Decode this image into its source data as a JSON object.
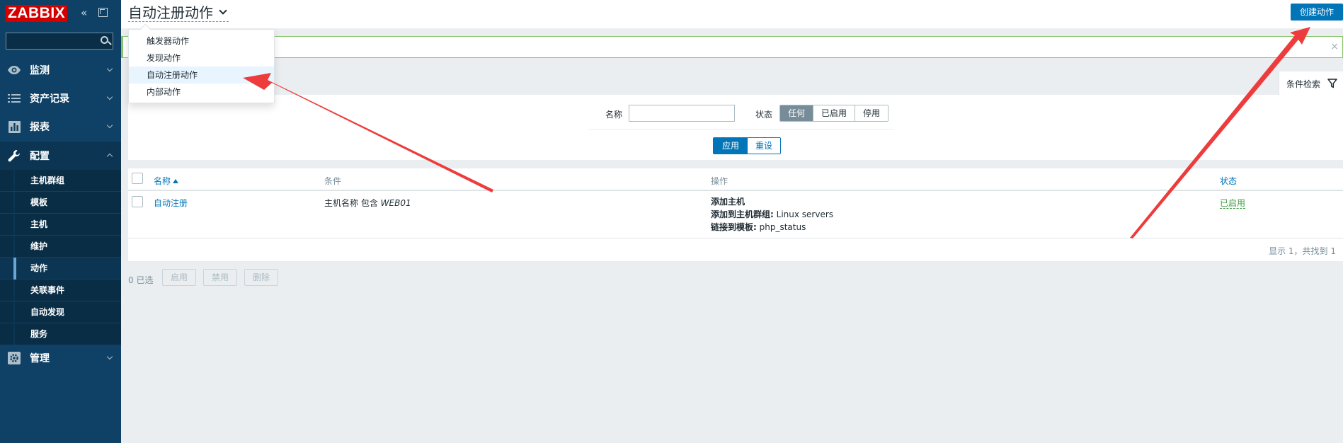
{
  "sidebar": {
    "logo": "ZABBIX",
    "collapse_icon": "collapse-icon",
    "kiosk_icon": "kiosk-mode-icon",
    "search": {
      "placeholder": "",
      "value": ""
    },
    "menu": [
      {
        "label": "监测",
        "icon": "eye-icon"
      },
      {
        "label": "资产记录",
        "icon": "list-icon"
      },
      {
        "label": "报表",
        "icon": "bar-chart-icon"
      },
      {
        "label": "配置",
        "icon": "wrench-icon"
      },
      {
        "label": "管理",
        "icon": "gear-icon"
      }
    ],
    "submenu": [
      {
        "label": "主机群组"
      },
      {
        "label": "模板"
      },
      {
        "label": "主机"
      },
      {
        "label": "维护"
      },
      {
        "label": "动作"
      },
      {
        "label": "关联事件"
      },
      {
        "label": "自动发现"
      },
      {
        "label": "服务"
      }
    ]
  },
  "header": {
    "title": "自动注册动作",
    "create_button": "创建动作"
  },
  "dropdown": {
    "items": [
      {
        "label": "触发器动作"
      },
      {
        "label": "发现动作"
      },
      {
        "label": "自动注册动作"
      },
      {
        "label": "内部动作"
      }
    ]
  },
  "message": {
    "close": "×"
  },
  "filter": {
    "tab_label": "条件检索",
    "name_label": "名称",
    "name_value": "",
    "status_label": "状态",
    "status_options": [
      "任何",
      "已启用",
      "停用"
    ],
    "status_selected": "任何",
    "apply_button": "应用",
    "reset_button": "重设"
  },
  "table": {
    "columns": {
      "name": "名称",
      "conditions": "条件",
      "operations": "操作",
      "status": "状态"
    },
    "rows": [
      {
        "name": "自动注册",
        "condition_prefix": "主机名称 包含 ",
        "condition_value": "WEB01",
        "operations": [
          {
            "label": "添加主机",
            "value": ""
          },
          {
            "label": "添加到主机群组:",
            "value": " Linux servers"
          },
          {
            "label": "链接到模板:",
            "value": " php_status"
          }
        ],
        "status": "已启用"
      }
    ],
    "paging": "显示 1，共找到 1"
  },
  "bulk": {
    "selected_count": "0 已选",
    "enable_button": "启用",
    "disable_button": "禁用",
    "delete_button": "删除"
  },
  "colors": {
    "sidebar_bg": "#0e4165",
    "accent": "#0275b8",
    "logo_bg": "#d40000",
    "status_enabled": "#429e47",
    "annotation_arrow": "#ee3b3b"
  }
}
